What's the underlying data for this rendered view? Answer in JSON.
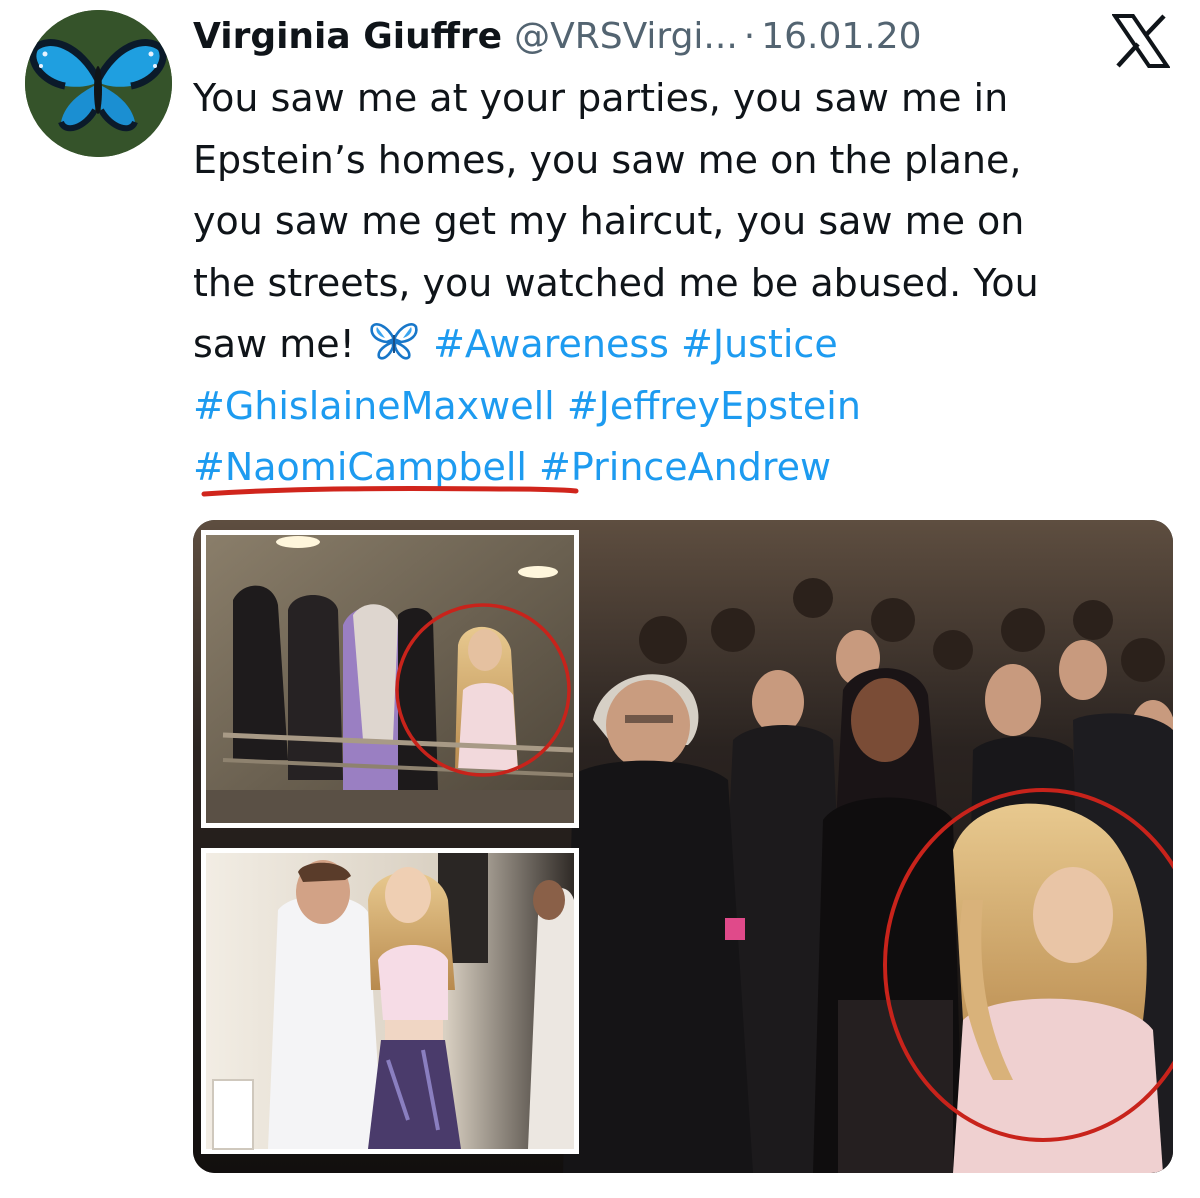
{
  "tweet": {
    "author_name": "Virginia Giuffre",
    "handle": "@VRSVirgi...",
    "separator": "·",
    "date": "16.01.20",
    "text_lines": [
      "You saw me at your parties, you saw me in",
      "Epstein’s homes, you saw me on the plane,",
      "you saw me get my haircut, you saw me on",
      "the streets, you watched me be abused. You"
    ],
    "last_line_prefix": "saw me!",
    "emoji": "butterfly-emoji",
    "hashtags": [
      "#Awareness",
      "#Justice",
      "#GhislaineMaxwell",
      "#JeffreyEpstein",
      "#NaomiCampbell",
      "#PrinceAndrew"
    ]
  },
  "annotation": {
    "underlined_hashtag": "#NaomiCampbell",
    "mark_color": "#d0251c"
  },
  "icons": {
    "avatar": "blue-butterfly-avatar",
    "platform_logo": "x-logo-icon"
  },
  "colors": {
    "link": "#1d9bf0",
    "secondary_text": "#536471",
    "text": "#0f1419",
    "circle_annotation": "#c8231b"
  }
}
